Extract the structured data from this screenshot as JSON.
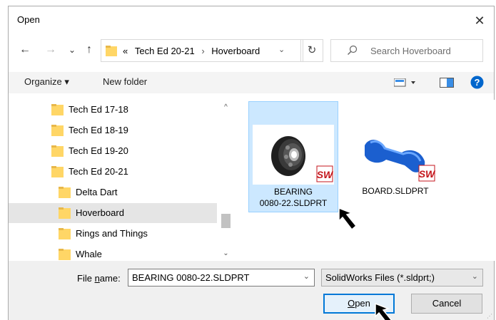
{
  "window": {
    "title": "Open",
    "close_glyph": "✕"
  },
  "nav": {
    "back_glyph": "←",
    "forward_glyph": "→",
    "recent_glyph": "⌄",
    "up_glyph": "↑",
    "address": {
      "chevrons": "«",
      "parent": "Tech Ed 20-21",
      "separator": "›",
      "current": "Hoverboard",
      "dropdown_glyph": "⌄"
    },
    "refresh_glyph": "↻",
    "search_placeholder": "Search Hoverboard"
  },
  "toolbar": {
    "organize_label": "Organize ▾",
    "new_folder_label": "New folder",
    "help_glyph": "?"
  },
  "tree": {
    "items": [
      {
        "label": "Tech Ed 17-18",
        "indent": 1,
        "selected": false
      },
      {
        "label": "Tech Ed 18-19",
        "indent": 1,
        "selected": false
      },
      {
        "label": "Tech Ed 19-20",
        "indent": 1,
        "selected": false
      },
      {
        "label": "Tech Ed 20-21",
        "indent": 1,
        "selected": false
      },
      {
        "label": "Delta Dart",
        "indent": 2,
        "selected": false
      },
      {
        "label": "Hoverboard",
        "indent": 2,
        "selected": true
      },
      {
        "label": "Rings and Things",
        "indent": 2,
        "selected": false
      },
      {
        "label": "Whale",
        "indent": 2,
        "selected": false
      }
    ],
    "scroll_up_glyph": "^",
    "scroll_down_glyph": "⌄"
  },
  "files": [
    {
      "name_line1": "BEARING",
      "name_line2": "0080-22.SLDPRT",
      "selected": true,
      "badge": "SW"
    },
    {
      "name_line1": "BOARD.SLDPRT",
      "name_line2": "",
      "selected": false,
      "badge": "SW"
    }
  ],
  "bottom": {
    "file_name_label_pre": "File ",
    "file_name_label_u": "n",
    "file_name_label_post": "ame:",
    "file_name_value": "BEARING 0080-22.SLDPRT",
    "filter_value": "SolidWorks Files (*.sldprt;)",
    "open_label_u": "O",
    "open_label_rest": "pen",
    "cancel_label": "Cancel",
    "dropdown_glyph": "⌄"
  },
  "colors": {
    "accent": "#0078d7",
    "selection": "#cce8ff",
    "folder": "#ffd666",
    "badge_red": "#c4161c"
  }
}
